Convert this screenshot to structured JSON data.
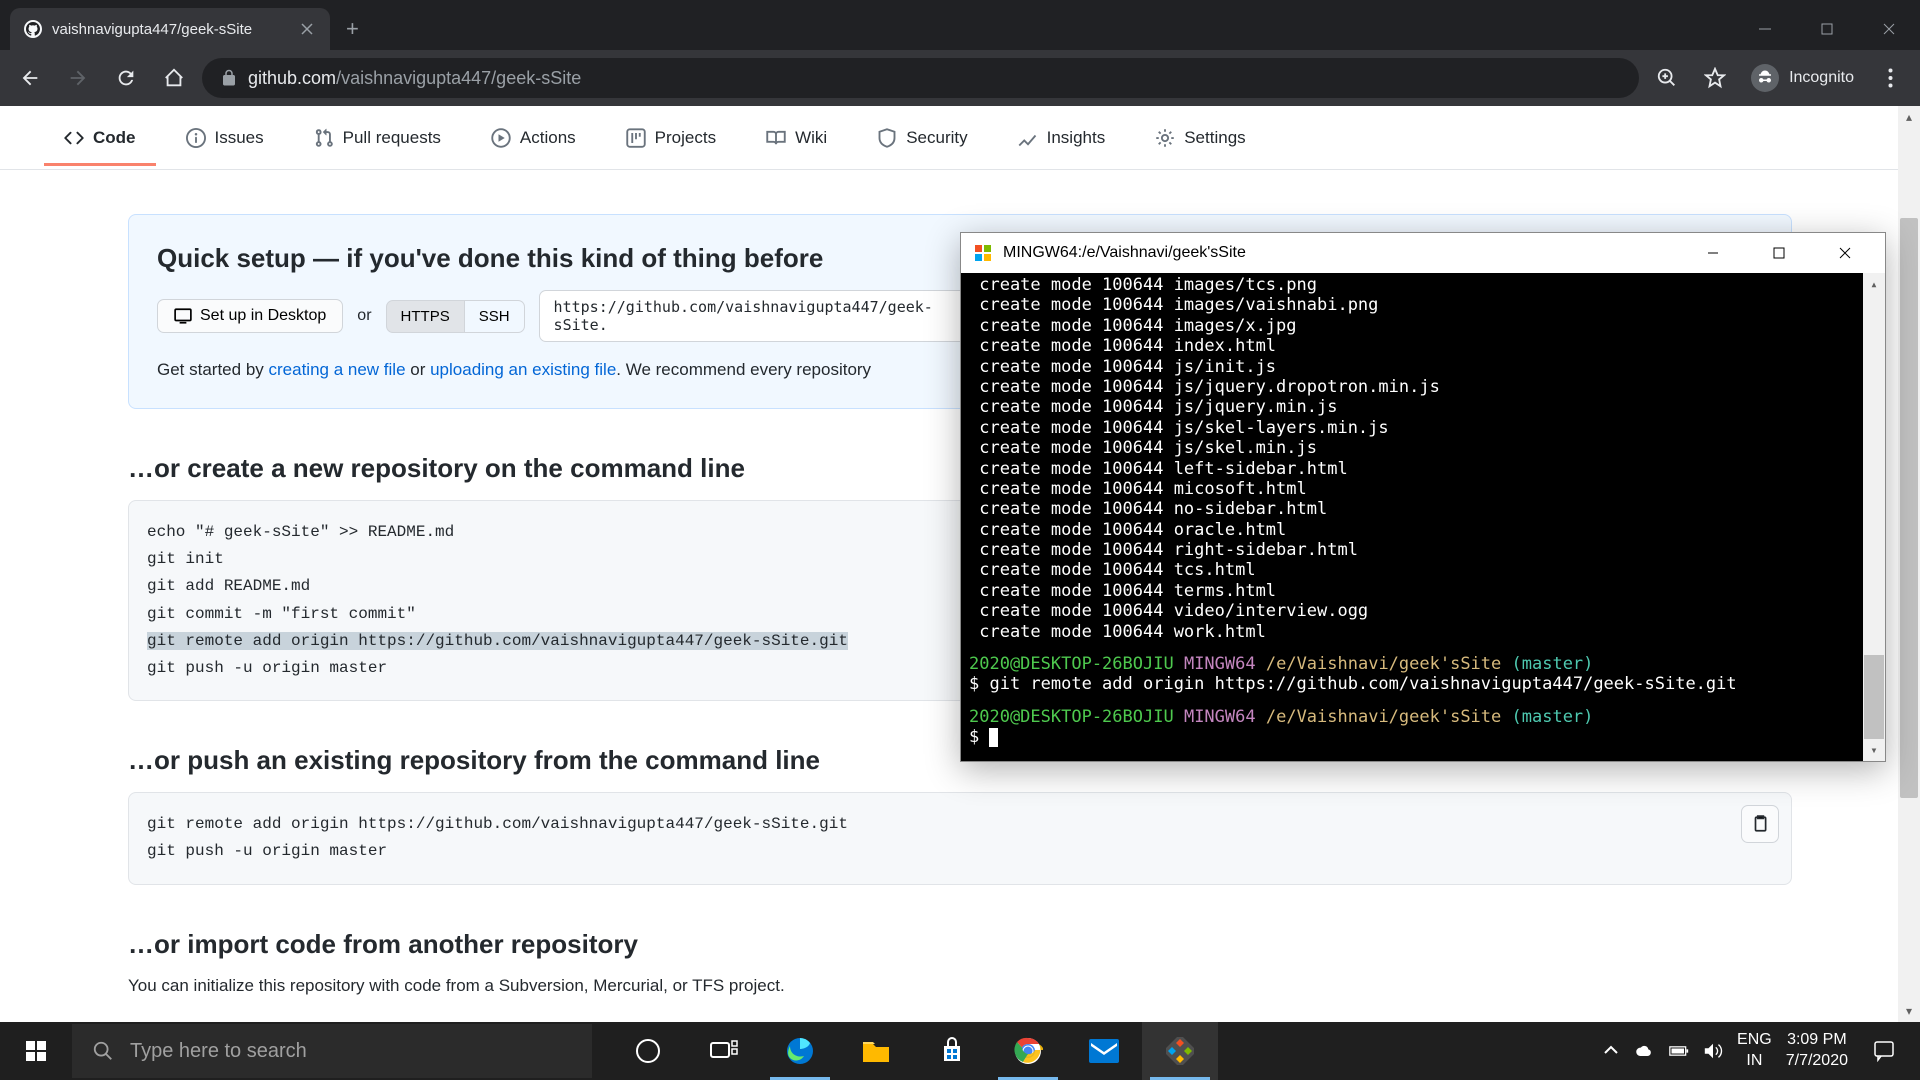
{
  "browser": {
    "tab_title": "vaishnavigupta447/geek-sSite",
    "url_domain": "github.com",
    "url_path": "/vaishnavigupta447/geek-sSite",
    "incognito_label": "Incognito"
  },
  "gh_tabs": {
    "code": "Code",
    "issues": "Issues",
    "pulls": "Pull requests",
    "actions": "Actions",
    "projects": "Projects",
    "wiki": "Wiki",
    "security": "Security",
    "insights": "Insights",
    "settings": "Settings"
  },
  "quick_setup": {
    "title": "Quick setup — if you've done this kind of thing before",
    "desktop_btn": "Set up in Desktop",
    "or": "or",
    "https": "HTTPS",
    "ssh": "SSH",
    "repo_url": "https://github.com/vaishnavigupta447/geek-sSite.",
    "desc_pre": "Get started by ",
    "create_link": "creating a new file",
    "desc_or": " or ",
    "upload_link": "uploading an existing file",
    "desc_post": ". We recommend every repository"
  },
  "section_create": {
    "title": "…or create a new repository on the command line",
    "code_l1": "echo \"# geek-sSite\" >> README.md",
    "code_l2": "git init",
    "code_l3": "git add README.md",
    "code_l4": "git commit -m \"first commit\"",
    "code_l5": "git remote add origin https://github.com/vaishnavigupta447/geek-sSite.git",
    "code_l6": "git push -u origin master"
  },
  "section_push": {
    "title": "…or push an existing repository from the command line",
    "code_l1": "git remote add origin https://github.com/vaishnavigupta447/geek-sSite.git",
    "code_l2": "git push -u origin master"
  },
  "section_import": {
    "title": "…or import code from another repository",
    "desc": "You can initialize this repository with code from a Subversion, Mercurial, or TFS project."
  },
  "terminal": {
    "title": "MINGW64:/e/Vaishnavi/geek'sSite",
    "lines": [
      " create mode 100644 images/tcs.png",
      " create mode 100644 images/vaishnabi.png",
      " create mode 100644 images/x.jpg",
      " create mode 100644 index.html",
      " create mode 100644 js/init.js",
      " create mode 100644 js/jquery.dropotron.min.js",
      " create mode 100644 js/jquery.min.js",
      " create mode 100644 js/skel-layers.min.js",
      " create mode 100644 js/skel.min.js",
      " create mode 100644 left-sidebar.html",
      " create mode 100644 micosoft.html",
      " create mode 100644 no-sidebar.html",
      " create mode 100644 oracle.html",
      " create mode 100644 right-sidebar.html",
      " create mode 100644 tcs.html",
      " create mode 100644 terms.html",
      " create mode 100644 video/interview.ogg",
      " create mode 100644 work.html"
    ],
    "prompt_user": "2020@DESKTOP-26BOJIU",
    "prompt_host": "MINGW64",
    "prompt_path": "/e/Vaishnavi/geek'sSite",
    "prompt_branch": "(master)",
    "command": "$ git remote add origin https://github.com/vaishnavigupta447/geek-sSite.git",
    "prompt2": "$ "
  },
  "taskbar": {
    "search_placeholder": "Type here to search",
    "lang1": "ENG",
    "lang2": "IN",
    "time": "3:09 PM",
    "date": "7/7/2020"
  }
}
